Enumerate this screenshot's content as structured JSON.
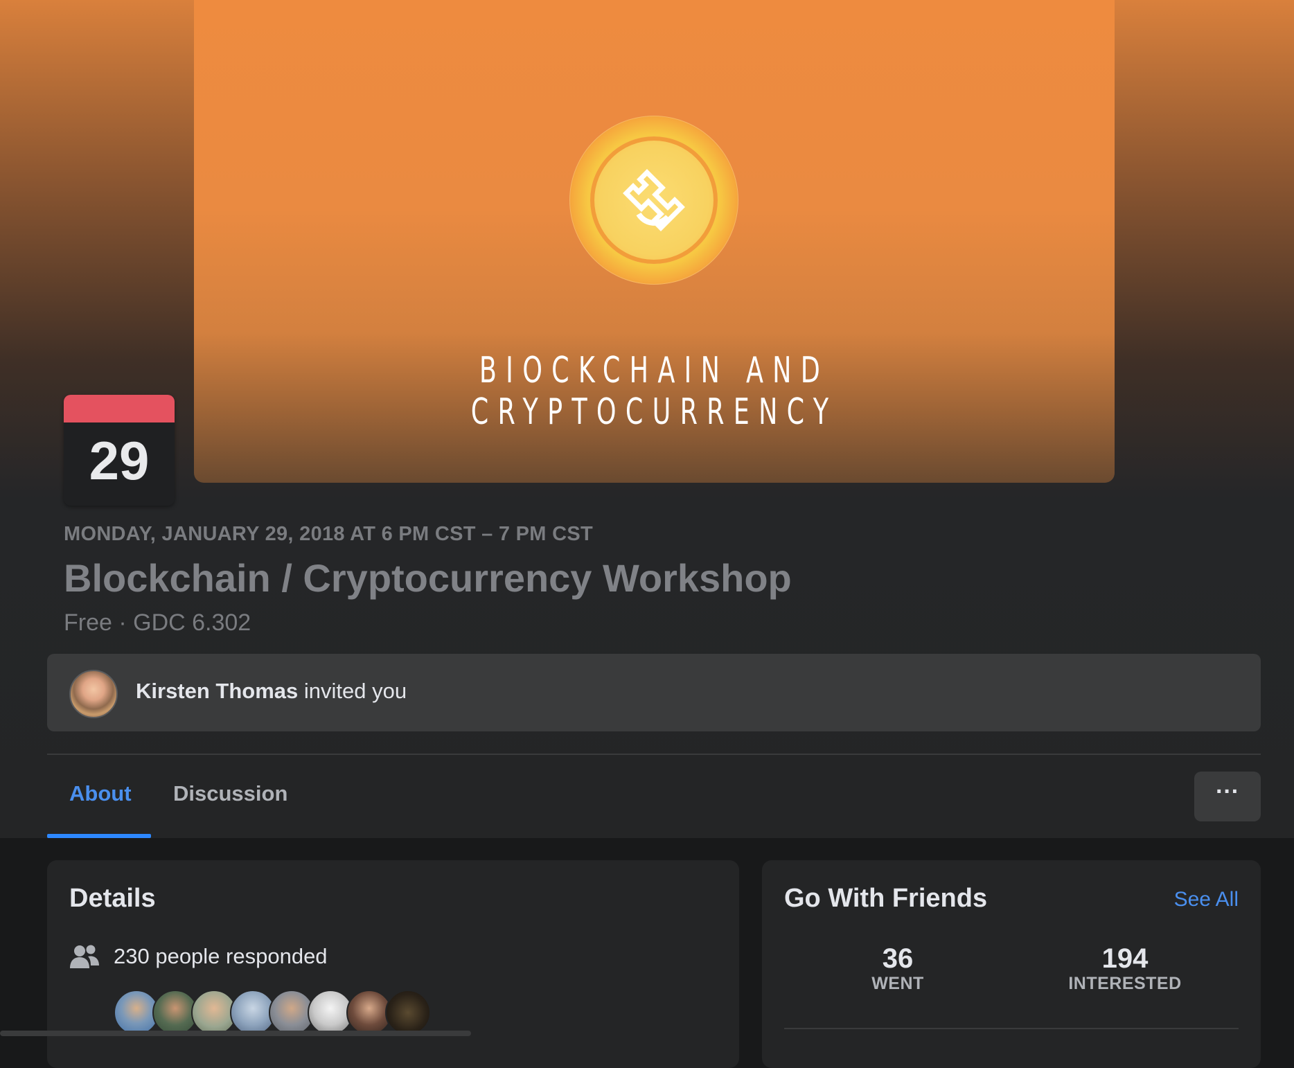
{
  "cover": {
    "title": "BIOCKCHAIN AND CRYPTOCURRENCY",
    "logo_icon": "crypto-coin-icon"
  },
  "calendar": {
    "day": "29"
  },
  "event": {
    "date": "MONDAY, JANUARY 29, 2018 AT 6 PM CST – 7 PM CST",
    "title": "Blockchain / Cryptocurrency Workshop",
    "subtitle": "Free · GDC 6.302"
  },
  "invite": {
    "inviter": "Kirsten Thomas",
    "suffix": " invited you"
  },
  "tabs": [
    {
      "label": "About",
      "active": true
    },
    {
      "label": "Discussion",
      "active": false
    }
  ],
  "more_label": "···",
  "details": {
    "heading": "Details",
    "responded": "230 people responded"
  },
  "friends": {
    "heading": "Go With Friends",
    "see_all": "See All",
    "went": {
      "count": "36",
      "label": "WENT"
    },
    "interested": {
      "count": "194",
      "label": "INTERESTED"
    }
  },
  "colors": {
    "accent": "#2d88ff",
    "calendar_band": "#e4525f",
    "cover": "#ee8b3f"
  }
}
